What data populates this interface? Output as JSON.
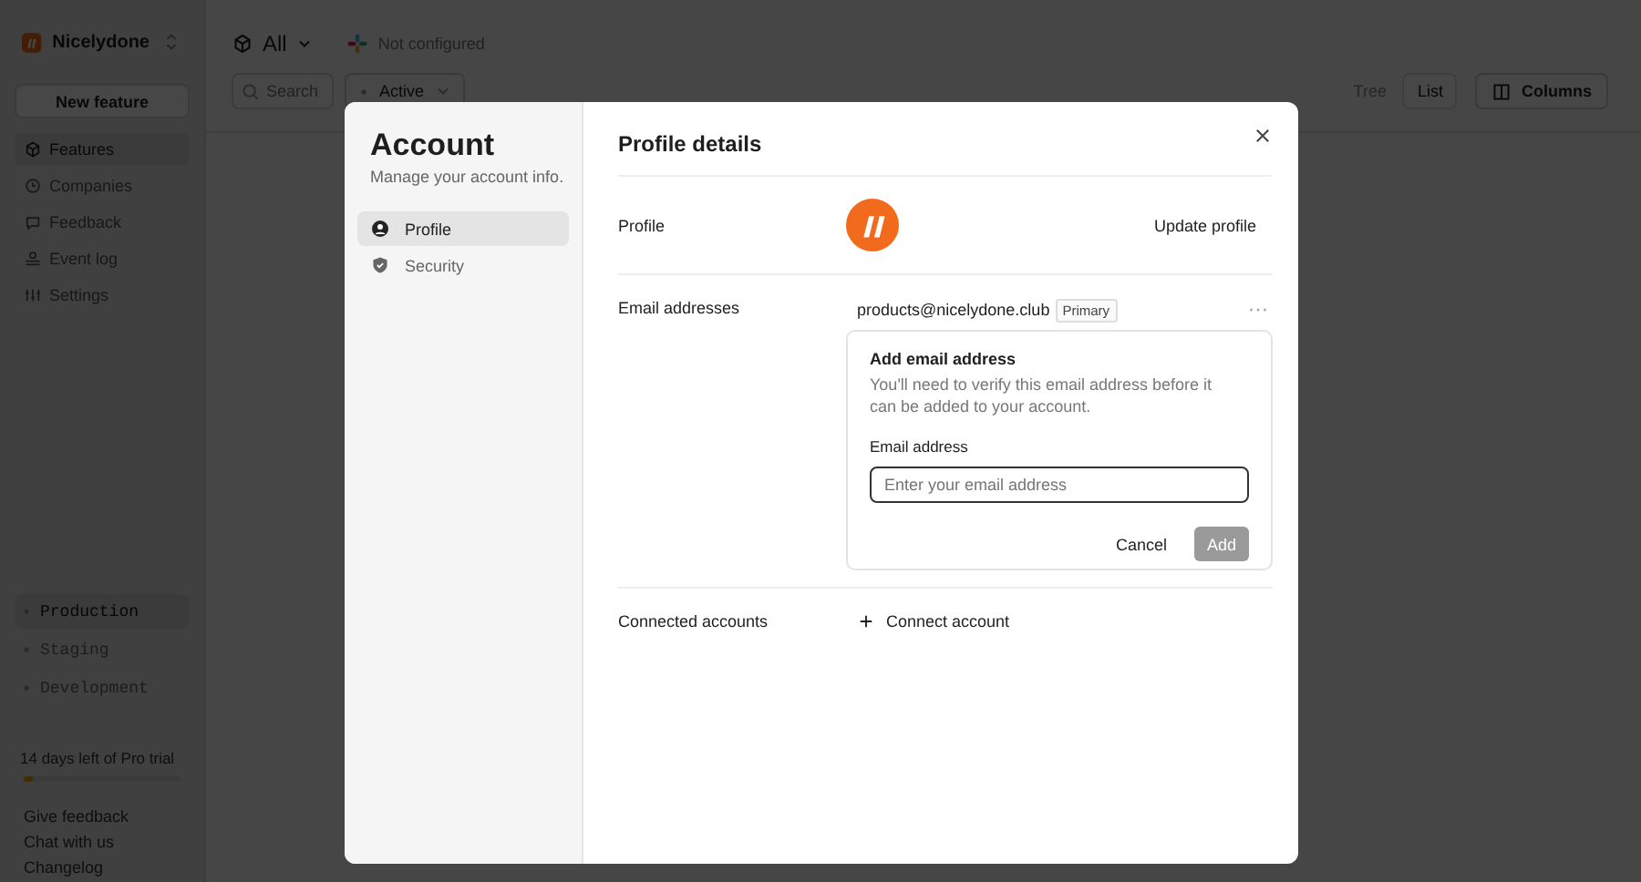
{
  "sidebar": {
    "workspace": "Nicelydone",
    "new_button": "New feature",
    "nav": [
      {
        "label": "Features",
        "selected": true
      },
      {
        "label": "Companies",
        "selected": false
      },
      {
        "label": "Feedback",
        "selected": false
      },
      {
        "label": "Event log",
        "selected": false
      },
      {
        "label": "Settings",
        "selected": false
      }
    ],
    "environments": [
      {
        "label": "Production",
        "selected": true
      },
      {
        "label": "Staging",
        "selected": false
      },
      {
        "label": "Development",
        "selected": false
      }
    ],
    "trial": {
      "text": "14 days left of Pro trial",
      "level": 0.06
    },
    "links": [
      "Give feedback",
      "Chat with us",
      "Changelog"
    ]
  },
  "toolbar": {
    "scope": "All",
    "integration": "Not configured"
  },
  "filters": {
    "search": {
      "placeholder": "Search"
    },
    "status": "Active"
  },
  "views": [
    {
      "label": "Tree",
      "selected": false
    },
    {
      "label": "List",
      "selected": true
    }
  ],
  "columns_button": "Columns",
  "modal": {
    "title": "Account",
    "subtitle": "Manage your account info.",
    "tabs": [
      {
        "label": "Profile",
        "selected": true
      },
      {
        "label": "Security",
        "selected": false
      }
    ],
    "heading": "Profile details",
    "profile": {
      "label": "Profile",
      "button": "Update profile"
    },
    "emails": {
      "label": "Email addresses",
      "address": "products@nicelydone.club",
      "badge": "Primary",
      "add": {
        "title": "Add email address",
        "text": "You'll need to verify this email address before it can be added to your account.",
        "field_label": "Email address",
        "placeholder": "Enter your email address",
        "cancel": "Cancel",
        "submit": "Add",
        "submit_disabled": true
      }
    },
    "connected": {
      "label": "Connected accounts",
      "button": "Connect account"
    }
  }
}
